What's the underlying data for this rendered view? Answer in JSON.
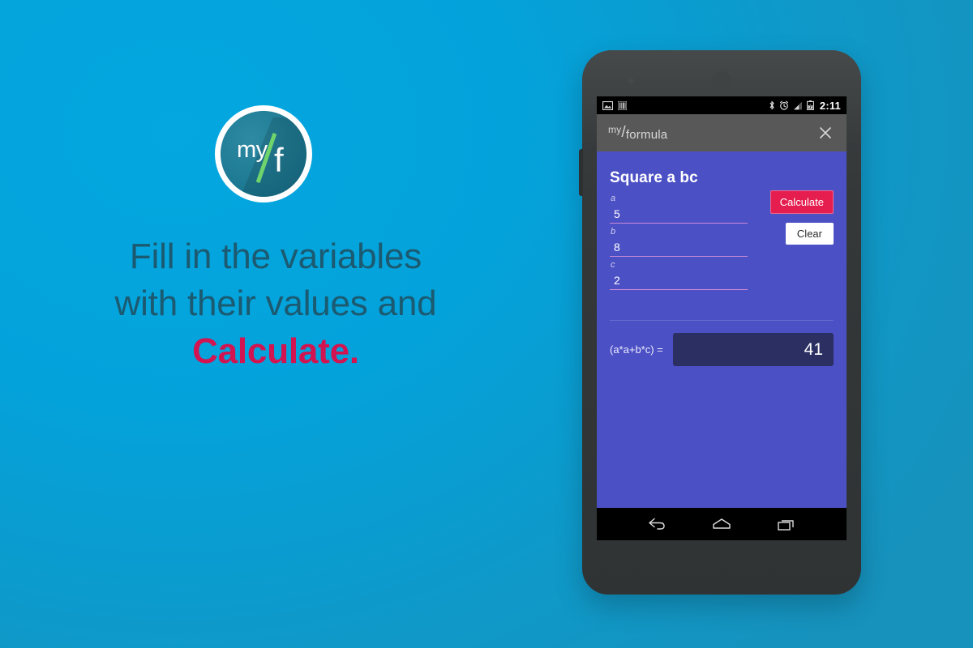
{
  "background": {
    "color_start": "#04a7e0",
    "color_end": "#1692bd"
  },
  "promo": {
    "logo": {
      "my_text": "my",
      "f_text": "f",
      "slash_color": "#6fd46b",
      "ring_color": "#ffffff",
      "disc_color": "#1b7791"
    },
    "headline": {
      "line1": "Fill in the variables",
      "line2": "with their values and",
      "accent": "Calculate.",
      "text_color": "#1b5a70",
      "accent_color": "#d21450"
    }
  },
  "phone": {
    "statusbar": {
      "icons_left": [
        "image-icon",
        "barcode-icon"
      ],
      "icons_right": [
        "bluetooth-icon",
        "alarm-icon",
        "signal-icon",
        "battery-charging-icon"
      ],
      "clock": "2:11"
    },
    "actionbar": {
      "title_my": "my",
      "title_slash": "/",
      "title_formula": "formula",
      "close_label": "×"
    },
    "app": {
      "formula_title": "Square a bc",
      "fields": [
        {
          "label": "a",
          "value": "5"
        },
        {
          "label": "b",
          "value": "8"
        },
        {
          "label": "c",
          "value": "2"
        }
      ],
      "calculate_label": "Calculate",
      "clear_label": "Clear",
      "result_label": "(a*a+b*c) =",
      "result_value": "41",
      "accent_color": "#e61e50",
      "app_bg_color": "#4c50c5",
      "result_box_color": "#2b2f62",
      "underline_color": "#c98ad4"
    },
    "navbar": {
      "buttons": [
        "back-icon",
        "home-icon",
        "recents-icon"
      ]
    }
  }
}
